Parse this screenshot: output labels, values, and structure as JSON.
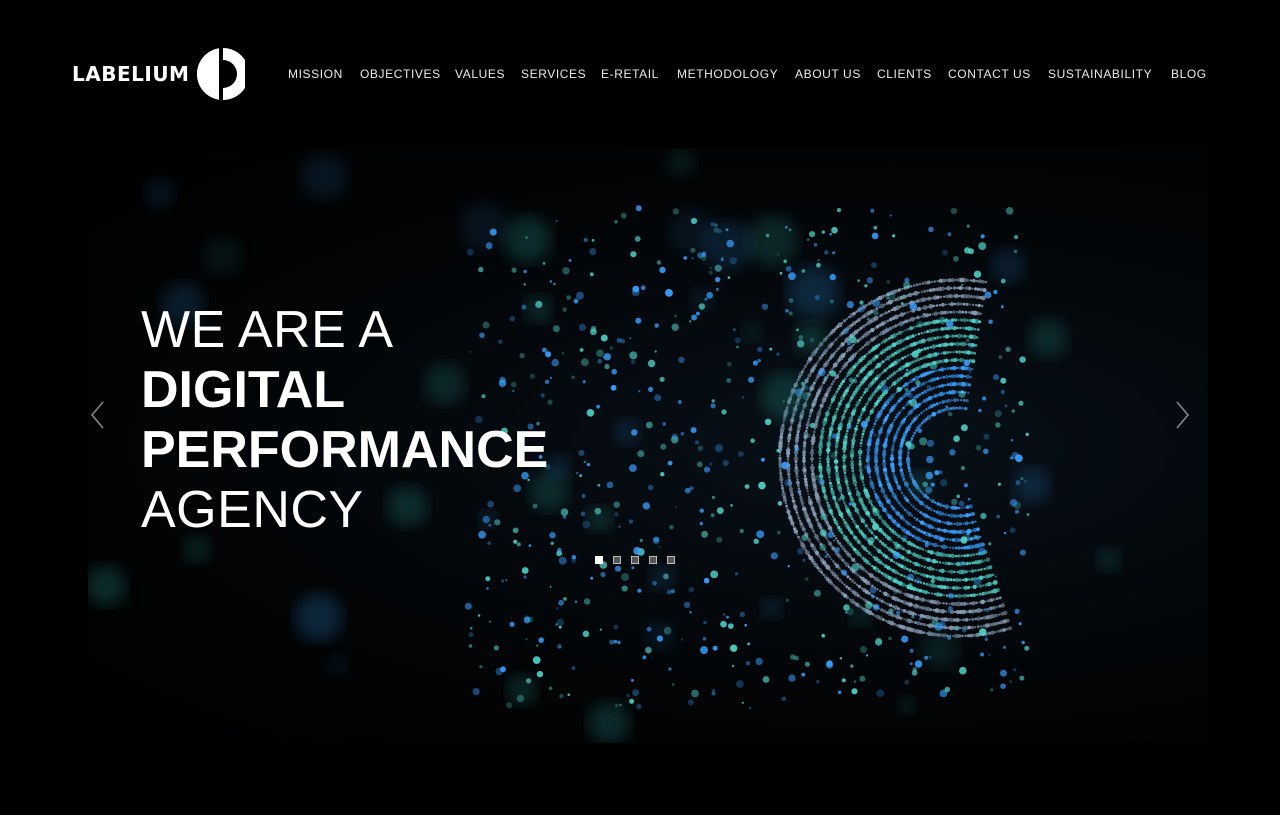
{
  "brand": {
    "name": "LABELIUM"
  },
  "nav": {
    "items": [
      {
        "label": "MISSION"
      },
      {
        "label": "OBJECTIVES"
      },
      {
        "label": "VALUES"
      },
      {
        "label": "SERVICES"
      },
      {
        "label": "E-RETAIL"
      },
      {
        "label": "METHODOLOGY"
      },
      {
        "label": "ABOUT US"
      },
      {
        "label": "CLIENTS"
      },
      {
        "label": "CONTACT US"
      },
      {
        "label": "SUSTAINABILITY"
      },
      {
        "label": "BLOG"
      }
    ]
  },
  "hero": {
    "line1": "WE ARE A",
    "line2": "DIGITAL",
    "line3": "PERFORMANCE",
    "line4": "AGENCY",
    "slides_total": 5,
    "active_slide": 1,
    "colors": {
      "accent_teal": "#4fd1c5",
      "accent_blue": "#3aa0ff",
      "background": "#000000"
    }
  },
  "icons": {
    "prev": "chevron-left-icon",
    "next": "chevron-right-icon"
  }
}
